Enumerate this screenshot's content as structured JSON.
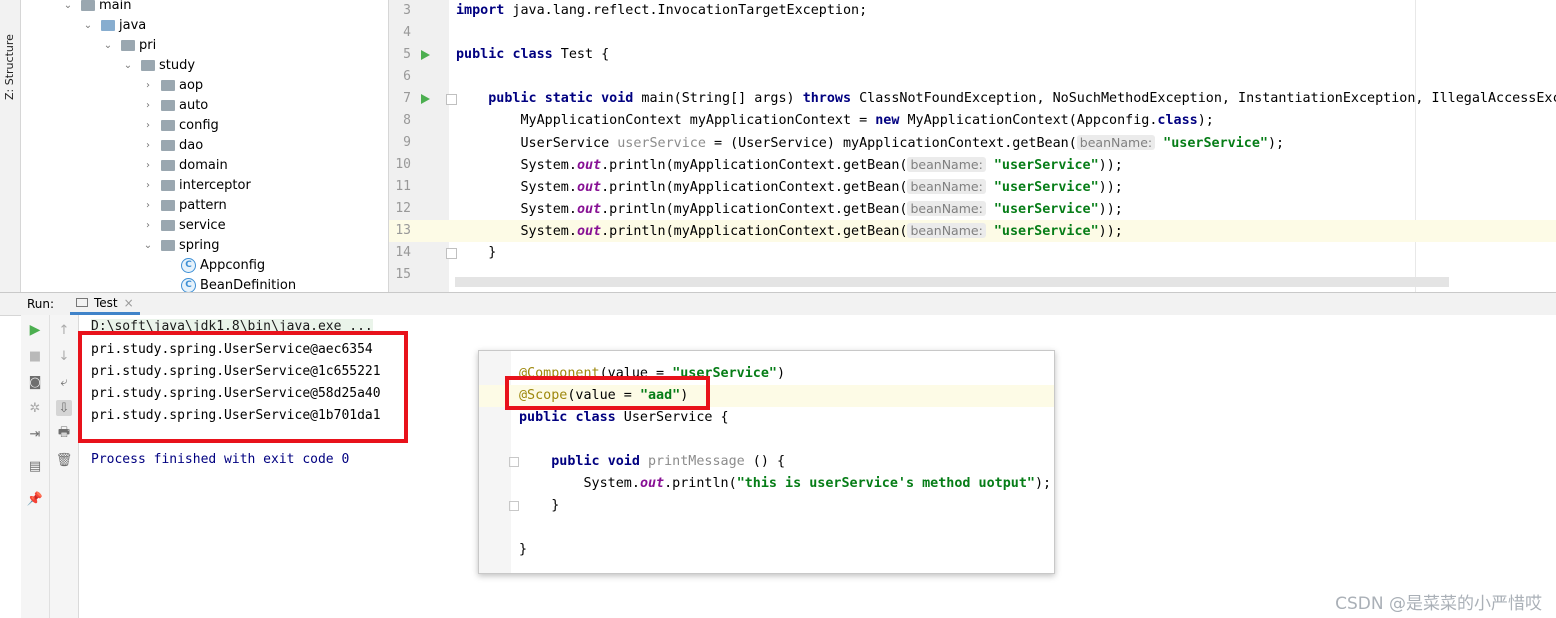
{
  "sidebar": {
    "structure_label": "Z: Structure"
  },
  "project_tree": [
    {
      "label": "main",
      "indent": 0,
      "expanded": true,
      "kind": "folder"
    },
    {
      "label": "java",
      "indent": 1,
      "expanded": true,
      "kind": "source-folder"
    },
    {
      "label": "pri",
      "indent": 2,
      "expanded": true,
      "kind": "package"
    },
    {
      "label": "study",
      "indent": 3,
      "expanded": true,
      "kind": "package"
    },
    {
      "label": "aop",
      "indent": 4,
      "expanded": false,
      "kind": "package"
    },
    {
      "label": "auto",
      "indent": 4,
      "expanded": false,
      "kind": "package"
    },
    {
      "label": "config",
      "indent": 4,
      "expanded": false,
      "kind": "package"
    },
    {
      "label": "dao",
      "indent": 4,
      "expanded": false,
      "kind": "package"
    },
    {
      "label": "domain",
      "indent": 4,
      "expanded": false,
      "kind": "package"
    },
    {
      "label": "interceptor",
      "indent": 4,
      "expanded": false,
      "kind": "package"
    },
    {
      "label": "pattern",
      "indent": 4,
      "expanded": false,
      "kind": "package"
    },
    {
      "label": "service",
      "indent": 4,
      "expanded": false,
      "kind": "package"
    },
    {
      "label": "spring",
      "indent": 4,
      "expanded": true,
      "kind": "package"
    },
    {
      "label": "Appconfig",
      "indent": 5,
      "expanded": null,
      "kind": "class"
    },
    {
      "label": "BeanDefinition",
      "indent": 5,
      "expanded": null,
      "kind": "class"
    }
  ],
  "editor": {
    "line_numbers": [
      "3",
      "4",
      "5",
      "6",
      "7",
      "8",
      "9",
      "10",
      "11",
      "12",
      "13",
      "14",
      "15"
    ],
    "import_kw": "import",
    "import_rest": " java.lang.reflect.InvocationTargetException;",
    "public_kw": "public",
    "class_kw": "class",
    "class_name": " Test {",
    "static_kw": "static",
    "void_kw": "void",
    "main_sig": " main(String[] args) ",
    "throws_kw": "throws",
    "throws_list": " ClassNotFoundException, NoSuchMethodException, InstantiationException, IllegalAccessExce",
    "line8_a": "MyApplicationContext myApplicationContext = ",
    "new_kw": "new",
    "line8_b": " MyApplicationContext(Appconfig.",
    "class_lit": "class",
    "line8_c": ");",
    "line9_a": "UserService ",
    "line9_var": "userService",
    "line9_b": " = (UserService) myApplicationContext.getBean(",
    "hint_bean_name": "beanName:",
    "str_user_service": "\"userService\"",
    "close_semi": ");",
    "close_double": "));",
    "sysout_a": "System.",
    "out_field": "out",
    "sysout_b": ".println(myApplicationContext.getBean(",
    "close_brace": "}"
  },
  "run_panel": {
    "run_label": "Run:",
    "tab_label": "Test",
    "tab_close": "×"
  },
  "console": {
    "command": "D:\\soft\\java\\jdk1.8\\bin\\java.exe ...",
    "outputs": [
      "pri.study.spring.UserService@aec6354",
      "pri.study.spring.UserService@1c655221",
      "pri.study.spring.UserService@58d25a40",
      "pri.study.spring.UserService@1b701da1"
    ],
    "finished": "Process finished with exit code 0"
  },
  "popup": {
    "component_anno": "@Component",
    "component_args_a": "(value = ",
    "component_str": "\"userService\"",
    "component_args_b": ")",
    "scope_anno": "@Scope",
    "scope_args_a": "(value = ",
    "scope_str": "\"aad\"",
    "scope_args_b": ")",
    "public_kw": "public",
    "class_kw": "class",
    "class_name": " UserService {",
    "void_kw": "void",
    "method_name": " printMessage",
    "method_rest": " () {",
    "sysout_a": "System.",
    "out_field": "out",
    "sysout_b": ".println(",
    "message_str": "\"this is userService's method uotput\"",
    "sysout_c": ");",
    "close_inner": "}",
    "close_outer": "}"
  },
  "watermark": "CSDN @是菜菜的小严惜哎",
  "colors": {
    "keyword": "#000080",
    "string": "#067d17",
    "annotation": "#9e880d",
    "static_field": "#871094",
    "highlight_box": "#e8121b",
    "run_green": "#4caf50"
  }
}
